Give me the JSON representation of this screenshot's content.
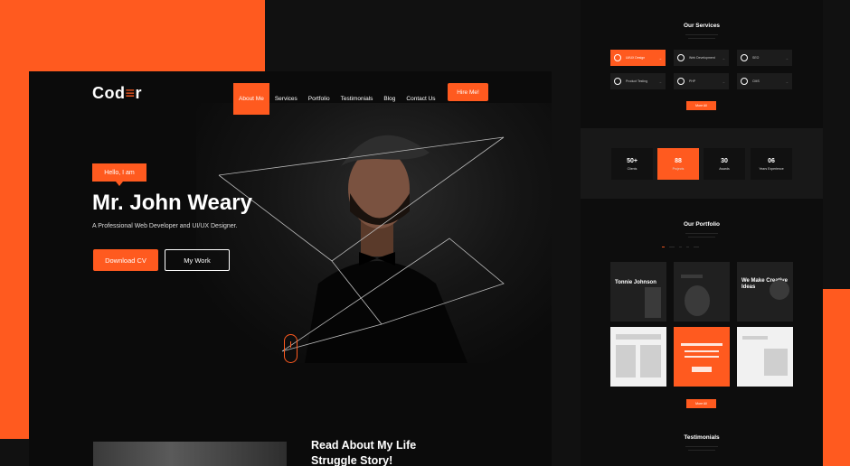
{
  "brand": {
    "logo_pre": "Cod",
    "logo_accent": "≡",
    "logo_post": "r",
    "accent_color": "#ff5a1f"
  },
  "nav": {
    "items": [
      "About Me",
      "Services",
      "Portfolio",
      "Testimonials",
      "Blog",
      "Contact Us"
    ],
    "active_index": 0,
    "hire_label": "Hire Me!"
  },
  "hero": {
    "badge": "Hello, I am",
    "name": "Mr. John Weary",
    "subtitle": "A Professional Web Developer and UI/UX Designer.",
    "primary_button": "Download CV",
    "secondary_button": "My Work"
  },
  "story": {
    "title_line1": "Read About My Life",
    "title_line2": "Struggle Story!"
  },
  "services": {
    "title": "Our Services",
    "items": [
      "UI/UX Design",
      "Web Development",
      "SEO",
      "Product Testing",
      "PHP",
      "CMS"
    ],
    "button": "More All"
  },
  "stats": [
    {
      "value": "50+",
      "label": "Clients"
    },
    {
      "value": "88",
      "label": "Projects"
    },
    {
      "value": "30",
      "label": "Awards"
    },
    {
      "value": "06",
      "label": "Years Experience"
    }
  ],
  "portfolio": {
    "title": "Our Portfolio",
    "tiles": [
      {
        "text": "Tonnie Johnson"
      },
      {
        "text": ""
      },
      {
        "text": "We Make Creative Ideas"
      },
      {
        "text": ""
      },
      {
        "text": ""
      },
      {
        "text": ""
      }
    ],
    "button": "More All"
  },
  "testimonials": {
    "title": "Testimonials"
  }
}
